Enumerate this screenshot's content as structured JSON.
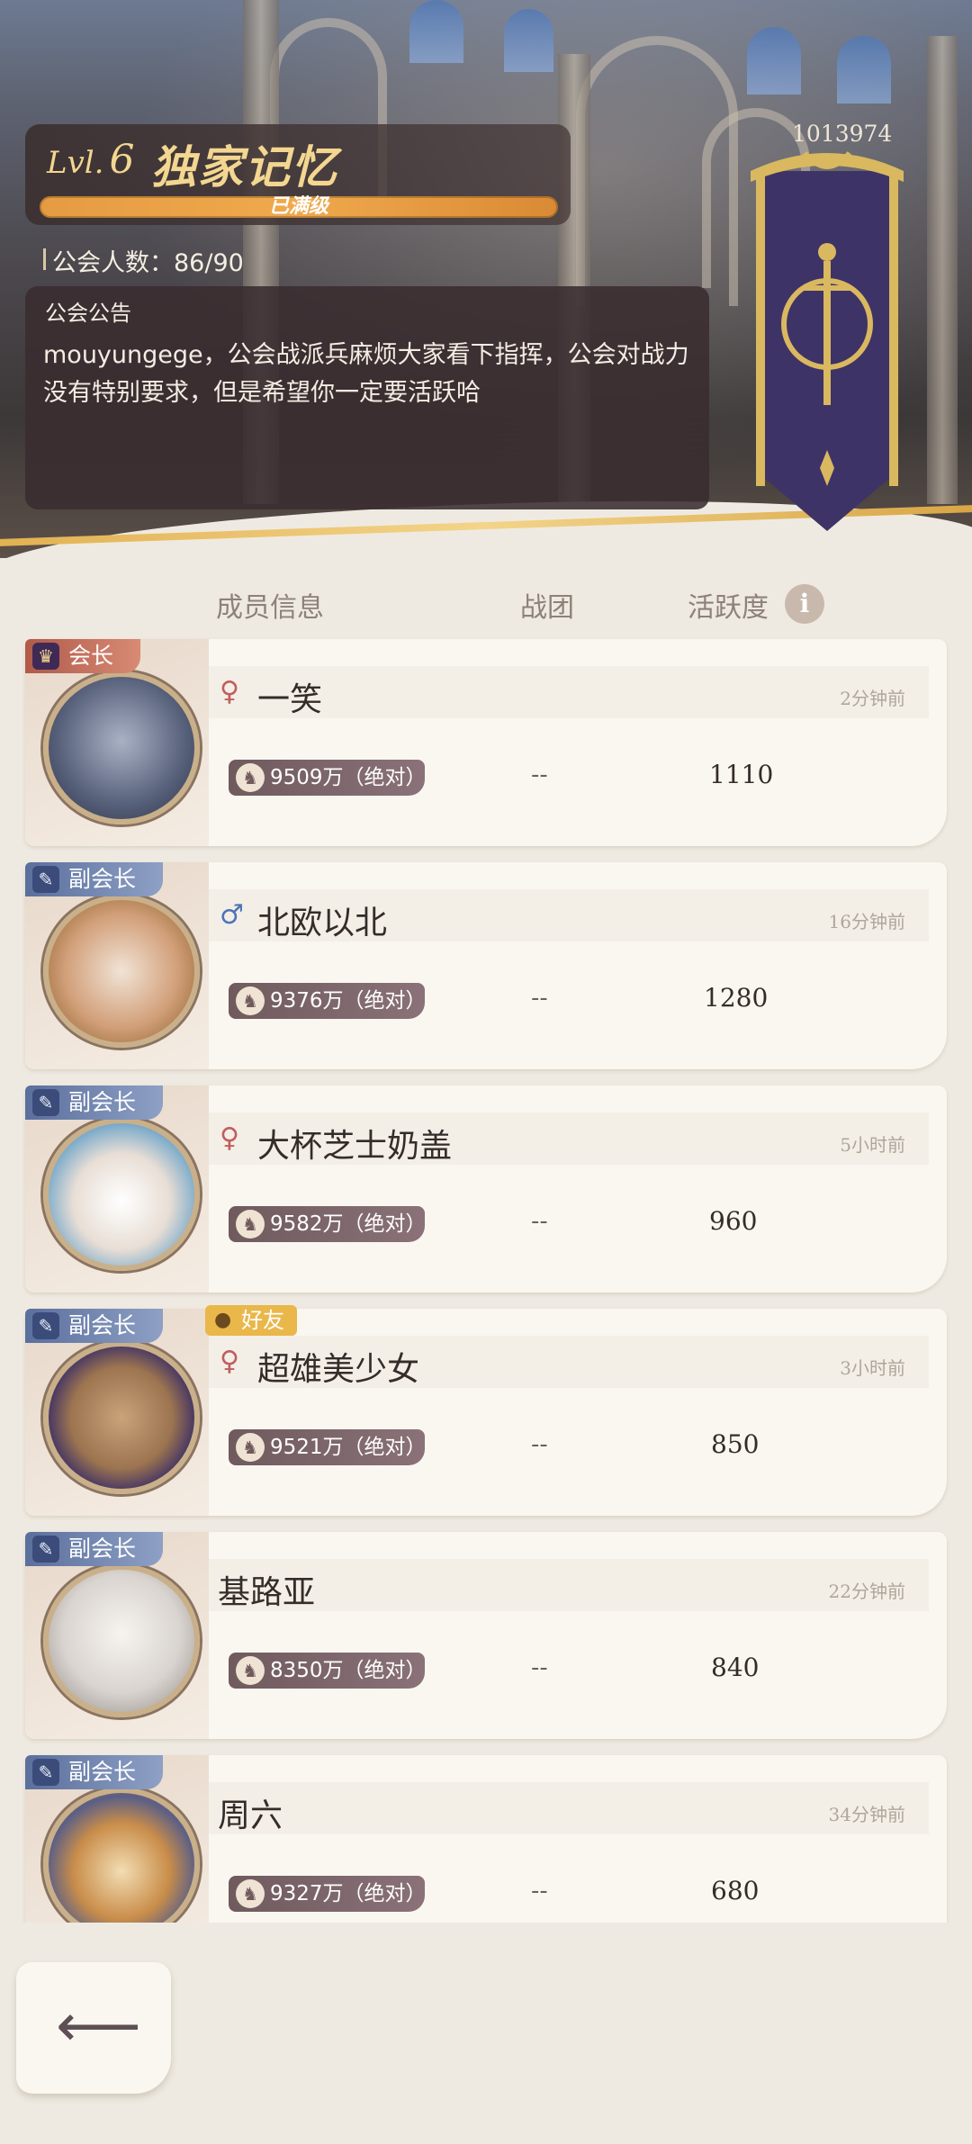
{
  "guild": {
    "level_prefix": "Lvl.",
    "level": "6",
    "name": "独家记忆",
    "level_status": "已满级",
    "member_count_label": "公会人数：86/90",
    "id": "1013974",
    "announcement_title": "公会公告",
    "announcement": "mouyungege，公会战派兵麻烦大家看下指挥，公会对战力没有特别要求，但是希望你一定要活跃哈"
  },
  "columns": {
    "info": "成员信息",
    "team": "战团",
    "activity": "活跃度",
    "info_icon": "i"
  },
  "members": [
    {
      "role": "会长",
      "name": "一笑",
      "time": "2分钟前",
      "power": "9509万（绝对）",
      "team": "--",
      "activity": "1110",
      "gender": "female",
      "friend": ""
    },
    {
      "role": "副会长",
      "name": "北欧以北",
      "time": "16分钟前",
      "power": "9376万（绝对）",
      "team": "--",
      "activity": "1280",
      "gender": "male",
      "friend": ""
    },
    {
      "role": "副会长",
      "name": "大杯芝士奶盖",
      "time": "5小时前",
      "power": "9582万（绝对）",
      "team": "--",
      "activity": "960",
      "gender": "female",
      "friend": ""
    },
    {
      "role": "副会长",
      "name": "超雄美少女",
      "time": "3小时前",
      "power": "9521万（绝对）",
      "team": "--",
      "activity": "850",
      "gender": "female",
      "friend": "好友"
    },
    {
      "role": "副会长",
      "name": "基路亚",
      "time": "22分钟前",
      "power": "8350万（绝对）",
      "team": "--",
      "activity": "840",
      "gender": "",
      "friend": ""
    },
    {
      "role": "副会长",
      "name": "周六",
      "time": "34分钟前",
      "power": "9327万（绝对）",
      "team": "--",
      "activity": "680",
      "gender": "",
      "friend": ""
    }
  ],
  "icons": {
    "back": "back-arrow-icon",
    "crown": "crown-icon",
    "feather": "feather-icon",
    "friend": "person-icon",
    "power": "power-icon",
    "female": "female-icon",
    "male": "male-icon"
  },
  "colors": {
    "leader_tag": "#b05a4a",
    "vice_tag": "#5a6f9c",
    "friend_tag": "#e9b74a",
    "level_bar": "#e59b42",
    "title_gold": "#f3d690"
  }
}
